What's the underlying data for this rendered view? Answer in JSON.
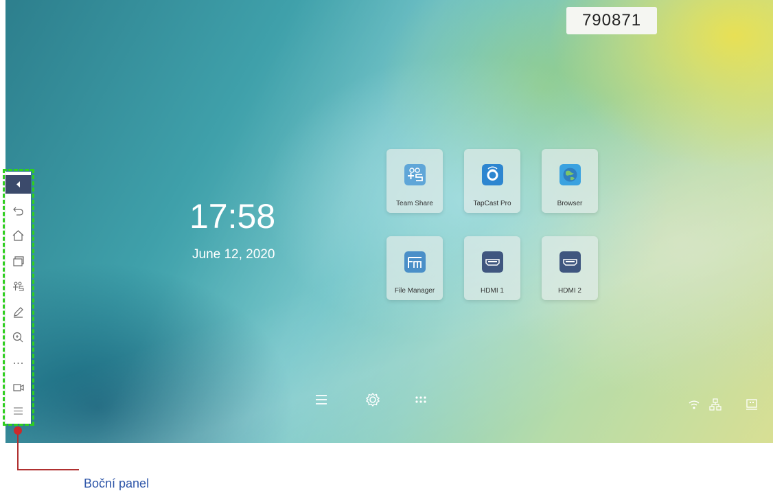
{
  "code": "790871",
  "clock": {
    "time": "17:58",
    "date": "June 12, 2020"
  },
  "apps": [
    {
      "label": "Team Share",
      "icon": "team-share-icon",
      "color": "#5fa6d8"
    },
    {
      "label": "TapCast Pro",
      "icon": "tapcast-icon",
      "color": "#2d86d0"
    },
    {
      "label": "Browser",
      "icon": "globe-icon",
      "color": "#3aa2e0"
    },
    {
      "label": "File Manager",
      "icon": "folder-icon",
      "color": "#4a8fc8"
    },
    {
      "label": "HDMI 1",
      "icon": "hdmi-icon",
      "color": "#3f567f"
    },
    {
      "label": "HDMI 2",
      "icon": "hdmi-icon",
      "color": "#3f567f"
    }
  ],
  "dock": [
    "menu-icon",
    "settings-icon",
    "apps-grid-icon"
  ],
  "status_icons": [
    "wifi-icon",
    "network-icon",
    "display-icon"
  ],
  "sidebar": {
    "collapse_icon": "chevron-left-icon",
    "items": [
      "back-icon",
      "home-icon",
      "windows-icon",
      "annotate-icon",
      "pen-icon",
      "zoom-icon",
      "more-icon",
      "source-icon",
      "menu-icon"
    ]
  },
  "callout": {
    "label": "Boční panel"
  },
  "colors": {
    "sidebar_accent": "#3b4a6b",
    "highlight": "#2fcf1f",
    "callout": "#cc2a2a",
    "callout_text": "#2d55a8"
  }
}
